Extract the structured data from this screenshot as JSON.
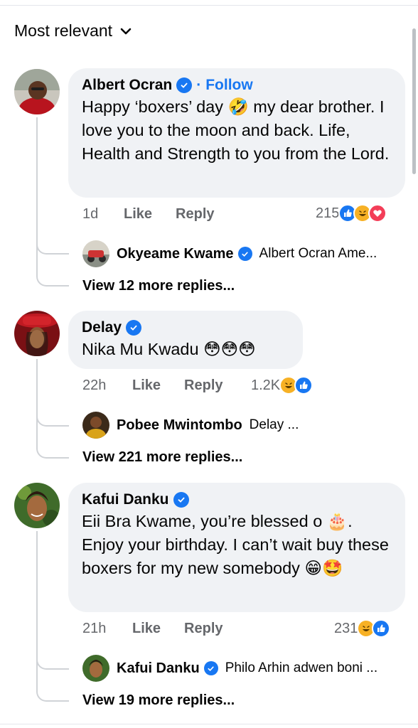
{
  "sort": {
    "label": "Most relevant"
  },
  "comments": [
    {
      "author": "Albert Ocran",
      "follow_sep": "·",
      "follow_label": "Follow",
      "text_1": "Happy ‘boxers’ day ",
      "emoji_1": "🤣",
      "text_2": " my dear brother. I love you to the moon and back. Life, Health and Strength to you from the Lord.",
      "time": "1d",
      "like_label": "Like",
      "reply_label": "Reply",
      "reaction_count": "215",
      "reactions": [
        "like-icon",
        "haha-icon",
        "love-icon"
      ],
      "reply_preview": {
        "author": "Okyeame Kwame",
        "snippet": "Albert Ocran Ame..."
      },
      "view_more": "View 12 more replies..."
    },
    {
      "author": "Delay",
      "text": "Nika Mu Kwadu 😳😳😳",
      "time": "22h",
      "like_label": "Like",
      "reply_label": "Reply",
      "reaction_count": "1.2K",
      "reactions": [
        "haha-icon",
        "like-icon"
      ],
      "reply_preview": {
        "author": "Pobee Mwintombo",
        "snippet": "Delay ..."
      },
      "view_more": "View 221 more replies..."
    },
    {
      "author": "Kafui Danku",
      "text": "Eii Bra Kwame, you’re blessed o 🎂. Enjoy your birthday. I can’t wait buy these boxers for my new somebody 😁🤩",
      "time": "21h",
      "like_label": "Like",
      "reply_label": "Reply",
      "reaction_count": "231",
      "reactions": [
        "haha-icon",
        "like-icon"
      ],
      "reply_preview": {
        "author": "Kafui Danku",
        "snippet": "Philo Arhin adwen boni ..."
      },
      "view_more": "View 19 more replies..."
    }
  ],
  "colors": {
    "link": "#1877f2",
    "bubble": "#f0f2f5",
    "meta": "#65676b",
    "love": "#f33e58",
    "haha": "#f7b125"
  }
}
